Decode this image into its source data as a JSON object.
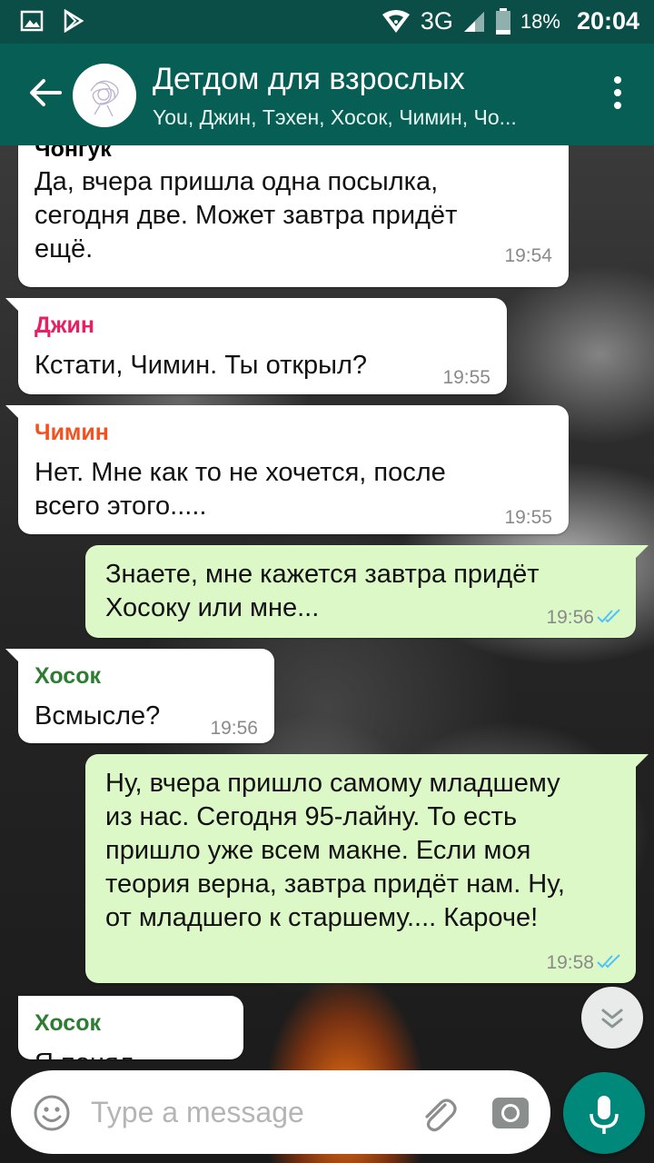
{
  "status_bar": {
    "network": "3G",
    "battery": "18%",
    "time": "20:04"
  },
  "header": {
    "title": "Детдом для взрослых",
    "members": "You, Джин, Тэхен, Хосок, Чимин, Чо..."
  },
  "colors": {
    "accent": "#075e54",
    "status_bar": "#0b4e48",
    "outgoing": "#dcf8c6",
    "incoming": "#ffffff",
    "mic": "#00897b",
    "read_ticks": "#4fc3f7"
  },
  "messages": [
    {
      "sender": "Чонгук",
      "sender_color": "#000000",
      "direction": "in",
      "lines": [
        "Да, вчера пришла одна посылка,",
        "сегодня две. Может завтра придёт",
        "ещё."
      ],
      "time": "19:54"
    },
    {
      "sender": "Джин",
      "sender_color": "#e91e63",
      "direction": "in",
      "lines": [
        "Кстати, Чимин. Ты открыл?"
      ],
      "time": "19:55"
    },
    {
      "sender": "Чимин",
      "sender_color": "#f4511e",
      "direction": "in",
      "lines": [
        "Нет. Мне как то не хочется, после",
        "всего этого....."
      ],
      "time": "19:55"
    },
    {
      "direction": "out",
      "lines": [
        "Знаете, мне кажется завтра придёт",
        "Хосоку или мне..."
      ],
      "time": "19:56",
      "status": "read"
    },
    {
      "sender": "Хосок",
      "sender_color": "#2e7d32",
      "direction": "in",
      "lines": [
        "Всмысле?"
      ],
      "time": "19:56"
    },
    {
      "direction": "out",
      "lines": [
        "Ну, вчера пришло самому младшему",
        "из нас. Сегодня 95-лайну. То есть",
        "пришло уже всем макне. Если моя",
        "теория верна, завтра придёт нам. Ну,",
        "от младшего к старшему.... Кароче!"
      ],
      "time": "19:58",
      "status": "read"
    },
    {
      "sender": "Хосок",
      "sender_color": "#2e7d32",
      "direction": "in",
      "lines": [
        "Я понял"
      ],
      "time": ""
    }
  ],
  "input": {
    "placeholder": "Type a message",
    "value": ""
  },
  "icons": {
    "back": "arrow-left-icon",
    "avatar": "group-avatar",
    "menu": "more-vert-icon",
    "emoji": "emoji-icon",
    "attach": "paperclip-icon",
    "camera": "camera-icon",
    "mic": "mic-icon",
    "scroll": "chevrons-down-icon",
    "ticks": "double-check-icon"
  }
}
